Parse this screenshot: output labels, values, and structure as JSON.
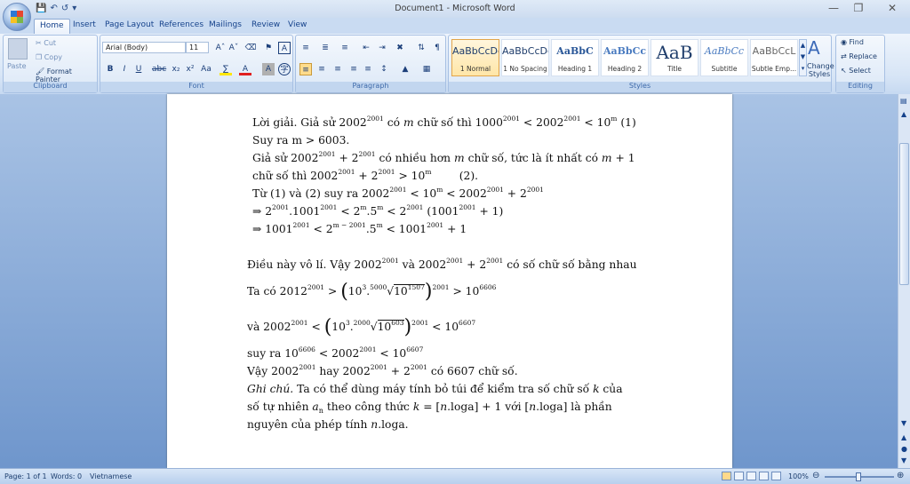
{
  "window": {
    "title": "Document1 - Microsoft Word"
  },
  "tabs": [
    "Home",
    "Insert",
    "Page Layout",
    "References",
    "Mailings",
    "Review",
    "View"
  ],
  "clipboard": {
    "paste": "Paste",
    "cut": "Cut",
    "copy": "Copy",
    "format_painter": "Format Painter",
    "label": "Clipboard"
  },
  "font": {
    "name": "Arial (Body)",
    "size": "11",
    "label": "Font"
  },
  "paragraph": {
    "label": "Paragraph"
  },
  "styles": {
    "items": [
      {
        "preview": "AaBbCcDc",
        "name": "1 Normal"
      },
      {
        "preview": "AaBbCcDc",
        "name": "1 No Spacing"
      },
      {
        "preview": "AaBbC",
        "name": "Heading 1"
      },
      {
        "preview": "AaBbCc",
        "name": "Heading 2"
      },
      {
        "preview": "AaB",
        "name": "Title"
      },
      {
        "preview": "AaBbCc",
        "name": "Subtitle"
      },
      {
        "preview": "AaBbCcL",
        "name": "Subtle Emp..."
      }
    ],
    "change_styles": "Change Styles",
    "label": "Styles"
  },
  "editing": {
    "find": "Find",
    "replace": "Replace",
    "select": "Select",
    "label": "Editing"
  },
  "status": {
    "page": "Page: 1 of 1",
    "words": "Words: 0",
    "language": "Vietnamese",
    "zoom": "100%"
  },
  "doc": {
    "l1a": "Lời giải. Giả sử 2002",
    "l1b": " có ",
    "l1c": " chữ số thì 1000",
    "l1d": " < 2002",
    "l1e": " < 10",
    "l1f": "  (1)",
    "l2": "Suy ra m > 6003.",
    "l3a": "Giả sử 2002",
    "l3b": " + 2",
    "l3c": " có nhiều hơn ",
    "l3d": " chữ số, tức là ít nhất có ",
    "l3e": " + 1",
    "l4a": "chữ số thì 2002",
    "l4b": " + 2",
    "l4c": " > 10",
    "l4d": "        (2).",
    "l5a": "Từ (1) và (2) suy ra 2002",
    "l5b": " < 10",
    "l5c": " < 2002",
    "l5d": " + 2",
    "l6a": "⇒ 2",
    "l6b": ".1001",
    "l6c": " < 2",
    "l6d": ".5",
    "l6e": " < 2",
    "l6f": " (1001",
    "l6g": " + 1)",
    "l7a": "⇒ 1001",
    "l7b": " < 2",
    "l7c": ".5",
    "l7d": " < 1001",
    "l7e": " + 1",
    "l8a": "Điều này vô lí. Vậy 2002",
    "l8b": " và 2002",
    "l8c": " + 2",
    "l8d": " có số chữ số bằng nhau",
    "l9a": "Ta có 2012",
    "l9b": " > ",
    "l9c": "10",
    "l9d": "3",
    "l9e": ".",
    "l9f": "5000",
    "l9g": "10",
    "l9h": "1507",
    "l9i": "2001",
    "l9j": " > 10",
    "l9k": "6606",
    "l10a": "và 2002",
    "l10b": " < ",
    "l10c": "10",
    "l10d": "3",
    "l10e": ".",
    "l10f": "2000",
    "l10g": "10",
    "l10h": "603",
    "l10i": "2001",
    "l10j": " < 10",
    "l10k": "6607",
    "l11a": "suy ra 10",
    "l11b": "6606",
    "l11c": " < 2002",
    "l11d": " < 10",
    "l11e": "6607",
    "l12a": "Vậy 2002",
    "l12b": " hay 2002",
    "l12c": " + 2",
    "l12d": " có 6607 chữ số.",
    "l13a": "Ghi chú.",
    "l13b": " Ta có thể dùng máy tính bỏ túi để kiểm tra số chữ số ",
    "l13c": " của",
    "l14a": "số tự nhiên ",
    "l14b": "a",
    "l14c": "n",
    "l14d": " theo công thức ",
    "l14e": " = [",
    "l14f": ".loga] + 1 với [",
    "l14g": ".loga] là phần",
    "l15a": "nguyên của phép tính ",
    "l15b": ".loga.",
    "e2001": "2001",
    "m": "m",
    "m_minus": "m − 2001",
    "k": "k",
    "n": "n"
  }
}
